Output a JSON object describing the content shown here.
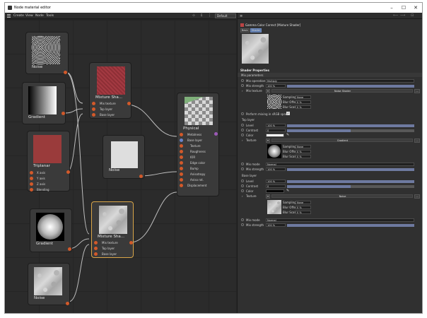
{
  "window": {
    "title": "Node material editor",
    "min": "–",
    "max": "☐",
    "close": "✕"
  },
  "menu": {
    "create": "Create",
    "view": "View",
    "node": "Node",
    "tools": "Tools",
    "preset": "Default",
    "tb1": "⊹",
    "tb2": "⇩",
    "tb3": "⋮"
  },
  "nodes": {
    "noise1": {
      "title": "Noise",
      "out": "out"
    },
    "gradient1": {
      "title": "Gradient"
    },
    "triplanar": {
      "title": "Triplanar",
      "inputs": [
        "X axis",
        "Y axis",
        "Z axis",
        "Blending"
      ]
    },
    "mix1": {
      "title": "Mixture Sha...",
      "inputs": [
        "Mix texture",
        "Top layer",
        "Base layer"
      ]
    },
    "noise2": {
      "title": "Noise"
    },
    "physical": {
      "title": "Physical",
      "inputs": [
        "Metalness",
        "Base layer",
        "Texture",
        "Roughness",
        "IOR",
        "Edge color",
        "Bump",
        "Anisotropy",
        "Aniso rot.",
        "Displacement"
      ]
    },
    "gradient2": {
      "title": "Gradient"
    },
    "mix2": {
      "title": "Mixture Sha...",
      "inputs": [
        "Mix texture",
        "Top layer",
        "Base layer"
      ]
    },
    "noise3": {
      "title": "Noise"
    }
  },
  "attr": {
    "header": "Gamma Color Correct [Mixture Shader]",
    "tab_basic": "Basic",
    "tab_shader": "Shader",
    "section": "Shader Properties",
    "mix_params": "Mix parameters",
    "mix_operation_label": "Mix operation",
    "mix_operation_value": "Multiply",
    "mix_strength_label": "Mix strength",
    "mix_strength_value": "100 %",
    "mix_strength_fraction": 1.0,
    "mix_texture_label": "Mix texture",
    "mix_texture_value": "Noise Shader",
    "sampling_label": "Sampling",
    "sampling_value": "None",
    "blur_offset_label": "Blur Offset",
    "blur_offset_value": "0 %",
    "blur_scale_label": "Blur Scale",
    "blur_scale_value": "0 %",
    "perform_label": "Perform mixing in sRGB space",
    "top_layer": "Top layer",
    "level_label": "Level",
    "level_value": "100 %",
    "contrast_label": "Contrast",
    "contrast_value": "0",
    "color_label": "Color",
    "texture_label": "Texture",
    "top_texture_value": "Gradient",
    "mix_mode_label": "Mix mode",
    "mix_mode_value": "Normal",
    "base_layer": "Base layer",
    "base_texture_value": "Noise",
    "more": "..."
  }
}
